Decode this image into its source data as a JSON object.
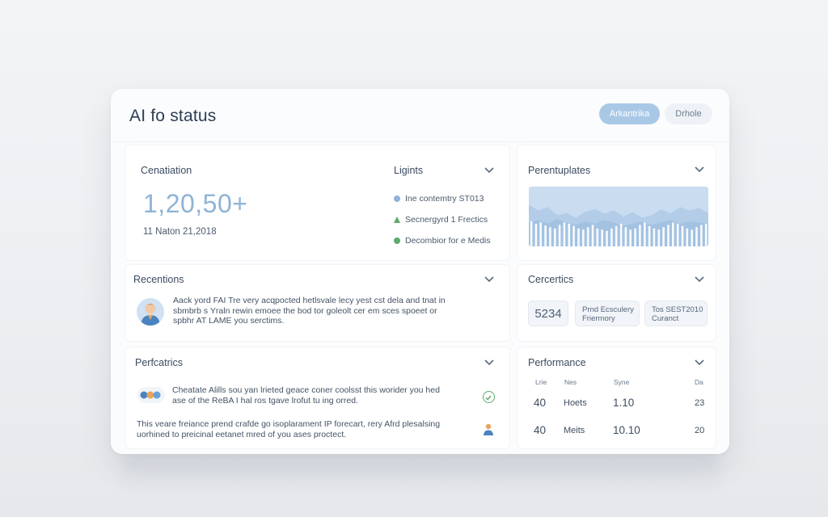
{
  "header": {
    "title": "AI fo status",
    "primary_button": "Arkantrika",
    "secondary_button": "Drhole"
  },
  "cards": {
    "cenatiation": {
      "title": "Cenatiation",
      "value": "1,20,50+",
      "date": "11 Naton 21,2018"
    },
    "insights": {
      "title": "Ligints",
      "items": [
        {
          "label": "Ine contemtry ST013",
          "icon": "circle-blue"
        },
        {
          "label": "Secnergyrd 1 Frectics",
          "icon": "triangle-green"
        },
        {
          "label": "Decombior for e Medis",
          "icon": "circle-green"
        }
      ]
    },
    "perentuplates": {
      "title": "Perentuplates"
    },
    "recentions": {
      "title": "Recentions",
      "text": "Aack yord FAI Tre very acqpocted hetlsvale lecy yest cst dela and tnat in sbmbrb s Yraln rewin emoee the bod tor goleolt cer em sces spoeet or spbhr AT LAME you serctims."
    },
    "cercertics": {
      "title": "Cercertics",
      "value": "5234",
      "pill2": "Prnd Ecsculery Friermory",
      "pill3": "Tos SEST2010 Curanct"
    },
    "perfcatrics": {
      "title": "Perfcatrics",
      "text1": "Cheatate Alills sou yan lrieted geace coner coolsst this worider you hed ase of the ReBA I hal ros tgave lrofut tu ing orred.",
      "text2": "This veare freiance prend crafde go isoplarament IP forecart, rery Afrd plesalsing uorhined to preicinal eetanet mred of you ases proctect."
    },
    "performance": {
      "title": "Performance",
      "columns": [
        "Lrie",
        "Nes",
        "Syne",
        "Da"
      ],
      "rows": [
        [
          "40",
          "Hoets",
          "1.10",
          "23"
        ],
        [
          "40",
          "Meits",
          "10.10",
          "20"
        ]
      ]
    }
  },
  "chart_data": {
    "type": "area",
    "title": "",
    "series": [
      {
        "values": [
          70,
          60,
          66,
          52,
          56,
          48,
          58,
          62,
          55,
          60,
          50,
          57,
          48,
          52,
          62,
          55,
          66,
          60,
          64,
          56
        ]
      },
      {
        "values": [
          40,
          44,
          38,
          46,
          40,
          36,
          42,
          38,
          44,
          40,
          34,
          38,
          42,
          36,
          40,
          44,
          38,
          42,
          40,
          38
        ]
      }
    ],
    "bars": [
      42,
      38,
      40,
      35,
      32,
      30,
      36,
      40,
      38,
      34,
      30,
      28,
      32,
      36,
      30,
      28,
      26,
      30,
      34,
      38,
      32,
      28,
      30,
      36,
      40,
      34,
      30,
      28,
      32,
      36,
      40,
      38,
      34,
      30,
      28,
      32,
      36,
      38
    ]
  },
  "colors": {
    "accent": "#a9c8e6",
    "chart_fill": "#c9dcf0",
    "success": "#5eaa6c"
  }
}
